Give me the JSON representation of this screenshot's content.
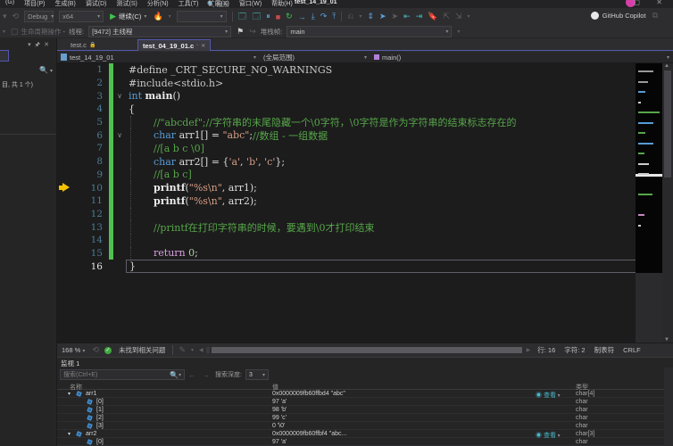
{
  "menu": {
    "items": [
      "(G)",
      "项目(P)",
      "生成(B)",
      "调试(D)",
      "测试(S)",
      "分析(N)",
      "工具(T)",
      "扩展(X)",
      "窗口(W)",
      "帮助(H)"
    ],
    "search": "搜索",
    "title": "test_14_19_01"
  },
  "toolbar": {
    "debug_config": "Debug",
    "platform": "x64",
    "continue_label": "继续(C)",
    "copilot_label": "GitHub Copilot"
  },
  "toolbar2": {
    "lifecycle": "生命周期操作",
    "thread_label": "线程:",
    "thread_value": "[9472] 主线程",
    "frame_label": "堆栈帧:",
    "frame_value": "main"
  },
  "tabs": {
    "inactive": "test.c",
    "active": "test_04_19_01.c"
  },
  "breadcrumb": {
    "file": "test_14_19_01",
    "scope": "(全局范围)",
    "function": "main()"
  },
  "code": {
    "current_line": 16,
    "arrow_line": 10,
    "fold_lines": [
      3,
      6
    ],
    "changed_lines": [
      1,
      2,
      3,
      4,
      5,
      6,
      7,
      8,
      9,
      10,
      11,
      12,
      13,
      14,
      15
    ],
    "lines": [
      {
        "n": 1,
        "ind": 0,
        "segs": [
          [
            "sd",
            "#define "
          ],
          [
            "sd",
            "_CRT_SECURE_NO_WARNINGS"
          ]
        ]
      },
      {
        "n": 2,
        "ind": 0,
        "segs": [
          [
            "sd",
            "#include<stdio.h>"
          ]
        ]
      },
      {
        "n": 3,
        "ind": 0,
        "segs": [
          [
            "sk",
            "int "
          ],
          [
            "sf",
            "main"
          ],
          [
            "sp",
            "()"
          ]
        ]
      },
      {
        "n": 4,
        "ind": 0,
        "segs": [
          [
            "sp",
            "{"
          ]
        ]
      },
      {
        "n": 5,
        "ind": 1,
        "segs": [
          [
            "sc",
            "//\"abcdef\";//字符串的末尾隐藏一个\\0字符，\\0字符是作为字符串的结束标志存在的"
          ]
        ]
      },
      {
        "n": 6,
        "ind": 1,
        "segs": [
          [
            "sk",
            "char "
          ],
          [
            "sv",
            "arr1"
          ],
          [
            "sp",
            "[] = "
          ],
          [
            "ss",
            "\"abc\""
          ],
          [
            "sp",
            ";"
          ],
          [
            "sc",
            "//数组 - 一组数据"
          ]
        ]
      },
      {
        "n": 7,
        "ind": 1,
        "segs": [
          [
            "sc",
            "//[a b c \\0]"
          ]
        ]
      },
      {
        "n": 8,
        "ind": 1,
        "segs": [
          [
            "sk",
            "char "
          ],
          [
            "sv",
            "arr2"
          ],
          [
            "sp",
            "[] = {"
          ],
          [
            "ss",
            "'a'"
          ],
          [
            "sp",
            ", "
          ],
          [
            "ss",
            "'b'"
          ],
          [
            "sp",
            ", "
          ],
          [
            "ss",
            "'c'"
          ],
          [
            "sp",
            "};"
          ]
        ]
      },
      {
        "n": 9,
        "ind": 1,
        "segs": [
          [
            "sc",
            "//[a b c]"
          ]
        ]
      },
      {
        "n": 10,
        "ind": 1,
        "segs": [
          [
            "sf",
            "printf"
          ],
          [
            "sp",
            "("
          ],
          [
            "ss",
            "\"%s\\n\""
          ],
          [
            "sp",
            ", "
          ],
          [
            "sv",
            "arr1"
          ],
          [
            "sp",
            ");"
          ]
        ]
      },
      {
        "n": 11,
        "ind": 1,
        "segs": [
          [
            "sf",
            "printf"
          ],
          [
            "sp",
            "("
          ],
          [
            "ss",
            "\"%s\\n\""
          ],
          [
            "sp",
            ", "
          ],
          [
            "sv",
            "arr2"
          ],
          [
            "sp",
            ");"
          ]
        ]
      },
      {
        "n": 12,
        "ind": 1,
        "segs": []
      },
      {
        "n": 13,
        "ind": 1,
        "segs": [
          [
            "sc",
            "//printf在打印字符串的时候，要遇到\\0才打印结束"
          ]
        ]
      },
      {
        "n": 14,
        "ind": 1,
        "segs": []
      },
      {
        "n": 15,
        "ind": 1,
        "segs": [
          [
            "sr",
            "return "
          ],
          [
            "sn",
            "0"
          ],
          [
            "sp",
            ";"
          ]
        ]
      },
      {
        "n": 16,
        "ind": 0,
        "segs": [
          [
            "sp",
            "}"
          ]
        ]
      }
    ]
  },
  "editor_status": {
    "zoom": "168 %",
    "issues": "未找到相关问题",
    "line": "行: 16",
    "char": "字符: 2",
    "tabs": "制表符",
    "eol": "CRLF"
  },
  "watch": {
    "tab": "监视 1",
    "search_placeholder": "搜索(Ctrl+E)",
    "depth_label": "搜索深度:",
    "depth_value": "3",
    "columns": {
      "name": "名称",
      "value": "值",
      "type": "类型"
    },
    "view_label": "查看",
    "rows": [
      {
        "name": "arr1",
        "value": "0x0000009fb60ffbd4 \"abc\"",
        "type": "char[4]",
        "level": 0,
        "expanded": true,
        "view": true
      },
      {
        "name": "[0]",
        "value": "97 'a'",
        "type": "char",
        "level": 1,
        "expanded": false,
        "view": false
      },
      {
        "name": "[1]",
        "value": "98 'b'",
        "type": "char",
        "level": 1,
        "expanded": false,
        "view": false
      },
      {
        "name": "[2]",
        "value": "99 'c'",
        "type": "char",
        "level": 1,
        "expanded": false,
        "view": false
      },
      {
        "name": "[3]",
        "value": "0 '\\0'",
        "type": "char",
        "level": 1,
        "expanded": false,
        "view": false
      },
      {
        "name": "arr2",
        "value": "0x0000009fb60ffbf4 \"abc...",
        "type": "char[3]",
        "level": 0,
        "expanded": true,
        "view": true
      },
      {
        "name": "[0]",
        "value": "97 'a'",
        "type": "char",
        "level": 1,
        "expanded": false,
        "view": false
      }
    ]
  },
  "sidebar": {
    "result_fragment": "目, 共 1 个)"
  },
  "glyphs": {
    "chevron_down": "▾",
    "chevron_up": "▴",
    "fold_open": "∨",
    "close": "✕",
    "lock": "🔒",
    "pin": "🖈",
    "search": "🔍",
    "check": "✓",
    "left": "◀",
    "right": "▶",
    "back": "←",
    "fwd": "→"
  }
}
